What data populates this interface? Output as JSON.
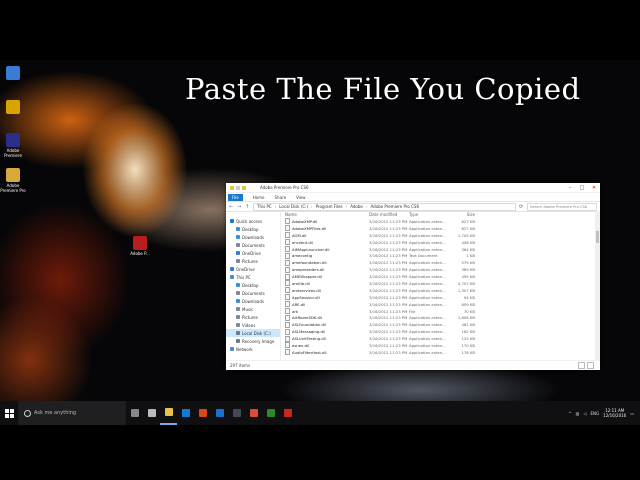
{
  "overlay_title": "Paste The File You Copied",
  "desktop_icons": [
    {
      "label": "",
      "color": "#3a7bd5"
    },
    {
      "label": "",
      "color": "#d9a400"
    },
    {
      "label": "Adobe Premiere",
      "color": "#2b2f8a"
    },
    {
      "label": "Adobe Premiere Pro",
      "color": "#d6a93a"
    },
    {
      "label": "Adobe P...",
      "color": "#b91d1d"
    }
  ],
  "explorer": {
    "title": "Adobe Premiere Pro CS6",
    "ribbon_tabs": [
      "File",
      "Home",
      "Share",
      "View"
    ],
    "address": [
      "This PC",
      "Local Disk (C:)",
      "Program Files",
      "Adobe",
      "Adobe Premiere Pro CS6"
    ],
    "search_placeholder": "Search Adobe Premiere Pro CS6",
    "nav_items": [
      {
        "label": "Quick access",
        "sub": false,
        "selected": false,
        "color": "#1979ca"
      },
      {
        "label": "Desktop",
        "sub": true,
        "selected": false,
        "color": "#3b8fd9"
      },
      {
        "label": "Downloads",
        "sub": true,
        "selected": false,
        "color": "#3b8fd9"
      },
      {
        "label": "Documents",
        "sub": true,
        "selected": false,
        "color": "#7a8a9a"
      },
      {
        "label": "OneDrive",
        "sub": true,
        "selected": false,
        "color": "#2f7de1"
      },
      {
        "label": "Pictures",
        "sub": true,
        "selected": false,
        "color": "#7a8a9a"
      },
      {
        "label": "OneDrive",
        "sub": false,
        "selected": false,
        "color": "#2f7de1"
      },
      {
        "label": "This PC",
        "sub": false,
        "selected": false,
        "color": "#4a8bd4"
      },
      {
        "label": "Desktop",
        "sub": true,
        "selected": false,
        "color": "#3b8fd9"
      },
      {
        "label": "Documents",
        "sub": true,
        "selected": false,
        "color": "#7a8a9a"
      },
      {
        "label": "Downloads",
        "sub": true,
        "selected": false,
        "color": "#3b8fd9"
      },
      {
        "label": "Music",
        "sub": true,
        "selected": false,
        "color": "#7a8a9a"
      },
      {
        "label": "Pictures",
        "sub": true,
        "selected": false,
        "color": "#7a8a9a"
      },
      {
        "label": "Videos",
        "sub": true,
        "selected": false,
        "color": "#7a8a9a"
      },
      {
        "label": "Local Disk (C:)",
        "sub": true,
        "selected": true,
        "color": "#6a7a8a"
      },
      {
        "label": "Recovery Image",
        "sub": true,
        "selected": false,
        "color": "#6a7a8a"
      },
      {
        "label": "Network",
        "sub": false,
        "selected": false,
        "color": "#4a8bd4"
      }
    ],
    "columns": {
      "name": "Name",
      "date": "Date modified",
      "type": "Type",
      "size": "Size"
    },
    "files": [
      {
        "name": "AdobeXMP.dll",
        "date": "3/16/2012 11:23 PM",
        "type": "Application exten...",
        "size": "827 KB"
      },
      {
        "name": "AdobeXMPFiles.dll",
        "date": "3/16/2012 11:23 PM",
        "type": "Application exten...",
        "size": "827 KB"
      },
      {
        "name": "AGM.dll",
        "date": "3/16/2012 11:23 PM",
        "type": "Application exten...",
        "size": "1,705 KB"
      },
      {
        "name": "ahclient.dll",
        "date": "3/16/2012 11:23 PM",
        "type": "Application exten...",
        "size": "408 KB"
      },
      {
        "name": "AIMAppLauncher.dll",
        "date": "3/16/2012 11:23 PM",
        "type": "Application exten...",
        "size": "364 KB"
      },
      {
        "name": "amecontig",
        "date": "3/16/2012 11:23 PM",
        "type": "Text Document",
        "size": "1 KB"
      },
      {
        "name": "amefoundation.dll",
        "date": "3/16/2012 11:23 PM",
        "type": "Application exten...",
        "size": "579 KB"
      },
      {
        "name": "amepreorders.dll",
        "date": "3/16/2012 11:23 PM",
        "type": "Application exten...",
        "size": "389 KB"
      },
      {
        "name": "AMEWrapper.dll",
        "date": "3/16/2012 11:23 PM",
        "type": "Application exten...",
        "size": "495 KB"
      },
      {
        "name": "amtlib.dll",
        "date": "3/16/2012 11:23 PM",
        "type": "Application exten...",
        "size": "4,707 KB"
      },
      {
        "name": "amtservices.dll",
        "date": "3/16/2012 11:23 PM",
        "type": "Application exten...",
        "size": "1,307 KB"
      },
      {
        "name": "AppSession.dll",
        "date": "3/16/2012 11:23 PM",
        "type": "Application exten...",
        "size": "94 KB"
      },
      {
        "name": "ARE.dll",
        "date": "3/16/2012 11:23 PM",
        "type": "Application exten...",
        "size": "809 KB"
      },
      {
        "name": "ark",
        "date": "3/16/2012 11:23 PM",
        "type": "File",
        "size": "70 KB"
      },
      {
        "name": "ArtRoomSDK.dll",
        "date": "3/16/2012 11:23 PM",
        "type": "Application exten...",
        "size": "1,808 KB"
      },
      {
        "name": "ASLFoundation.dll",
        "date": "3/16/2012 11:23 PM",
        "type": "Application exten...",
        "size": "461 KB"
      },
      {
        "name": "ASLMessaging.dll",
        "date": "3/16/2012 11:23 PM",
        "type": "Application exten...",
        "size": "162 KB"
      },
      {
        "name": "ASLUnitTesting.dll",
        "date": "3/16/2012 11:23 PM",
        "type": "Application exten...",
        "size": "125 KB"
      },
      {
        "name": "asneu.dll",
        "date": "3/16/2012 11:23 PM",
        "type": "Application exten...",
        "size": "170 KB"
      },
      {
        "name": "AudioFilterHost.dll",
        "date": "3/16/2012 11:23 PM",
        "type": "Application exten...",
        "size": "178 KB"
      }
    ],
    "status": "297 items"
  },
  "taskbar": {
    "search_placeholder": "Ask me anything",
    "apps": [
      {
        "name": "mic",
        "color": "#888888"
      },
      {
        "name": "task-view",
        "color": "#bbbbbb"
      },
      {
        "name": "file-explorer",
        "color": "#e8c34a",
        "active": true
      },
      {
        "name": "store",
        "color": "#0f7bd8"
      },
      {
        "name": "office",
        "color": "#d9481e"
      },
      {
        "name": "app-blue",
        "color": "#1b6fd1"
      },
      {
        "name": "app-dark",
        "color": "#444a55"
      },
      {
        "name": "chrome",
        "color": "#dd4b39"
      },
      {
        "name": "xbox",
        "color": "#2a8a2a"
      },
      {
        "name": "media",
        "color": "#c8281e"
      }
    ],
    "language": "ENG",
    "time": "12:11 AM",
    "date": "12/16/2016"
  }
}
